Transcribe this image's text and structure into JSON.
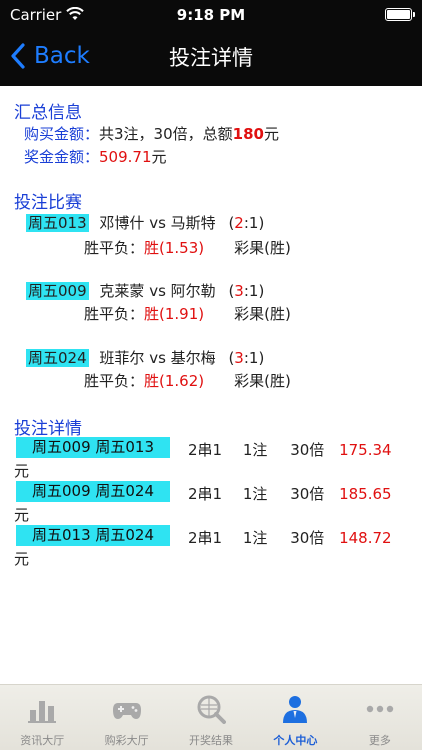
{
  "status": {
    "carrier": "Carrier",
    "time": "9:18 PM"
  },
  "nav": {
    "back": "Back",
    "title": "投注详情"
  },
  "summary": {
    "heading": "汇总信息",
    "buy_label": "购买金额：",
    "buy_prefix": "共3注，30倍，总额",
    "buy_amount": "180",
    "buy_unit": "元",
    "prize_label": "奖金金额：",
    "prize_amount": "509.71",
    "prize_unit": "元"
  },
  "matches": {
    "heading": "投注比赛",
    "items": [
      {
        "code": "周五013",
        "teams": "邓博什 vs 马斯特",
        "score_l": "(",
        "score_a": "2",
        "score_c": ":",
        "score_b": "1",
        "score_r": ")",
        "bet_label": "胜平负：",
        "bet_pick": "胜(1.53)",
        "result": "彩果(胜)"
      },
      {
        "code": "周五009",
        "teams": "克莱蒙 vs 阿尔勒",
        "score_l": "(",
        "score_a": "3",
        "score_c": ":",
        "score_b": "1",
        "score_r": ")",
        "bet_label": "胜平负：",
        "bet_pick": "胜(1.91)",
        "result": "彩果(胜)"
      },
      {
        "code": "周五024",
        "teams": "班菲尔 vs 基尔梅",
        "score_l": "(",
        "score_a": "3",
        "score_c": ":",
        "score_b": "1",
        "score_r": ")",
        "bet_label": "胜平负：",
        "bet_pick": "胜(1.62)",
        "result": "彩果(胜)"
      }
    ]
  },
  "details": {
    "heading": "投注详情",
    "rows": [
      {
        "combo": "周五009 周五013",
        "type": "2串1",
        "count": "1注",
        "multiple": "30倍",
        "amount": "175.34",
        "unit": "元"
      },
      {
        "combo": "周五009 周五024",
        "type": "2串1",
        "count": "1注",
        "multiple": "30倍",
        "amount": "185.65",
        "unit": "元"
      },
      {
        "combo": "周五013 周五024",
        "type": "2串1",
        "count": "1注",
        "multiple": "30倍",
        "amount": "148.72",
        "unit": "元"
      }
    ]
  },
  "tabbar": {
    "items": [
      {
        "label": "资讯大厅",
        "icon": "bar-chart-icon"
      },
      {
        "label": "购彩大厅",
        "icon": "gamepad-icon"
      },
      {
        "label": "开奖结果",
        "icon": "ball-magnifier-icon"
      },
      {
        "label": "个人中心",
        "icon": "person-icon",
        "active": true
      },
      {
        "label": "更多",
        "icon": "more-dots-icon"
      }
    ]
  },
  "colors": {
    "accent_blue": "#1a3fd6",
    "highlight_cyan": "#2fe3f2",
    "amount_red": "#e01010",
    "active_tab": "#1d5fd6"
  }
}
